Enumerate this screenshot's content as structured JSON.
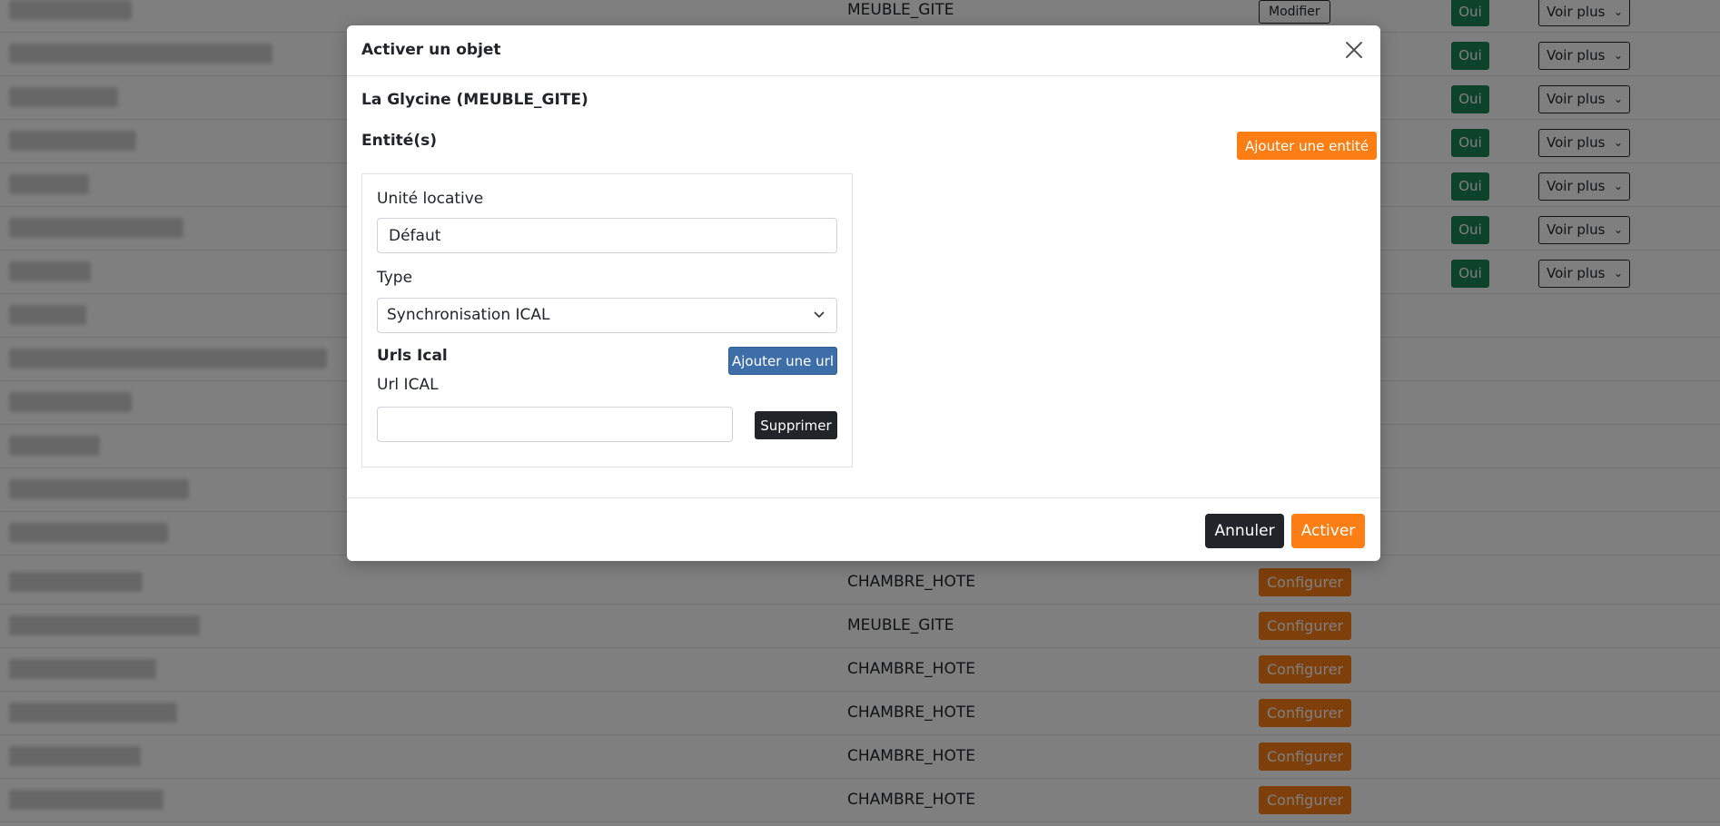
{
  "background_table": {
    "rows": [
      {
        "type": "MEUBLE_GITE",
        "action": "Modifier",
        "status": "Oui",
        "more": "Voir plus"
      },
      {
        "type": "",
        "action": "",
        "status": "Oui",
        "more": "Voir plus"
      },
      {
        "type": "",
        "action": "",
        "status": "Oui",
        "more": "Voir plus"
      },
      {
        "type": "",
        "action": "",
        "status": "Oui",
        "more": "Voir plus"
      },
      {
        "type": "",
        "action": "",
        "status": "Oui",
        "more": "Voir plus"
      },
      {
        "type": "",
        "action": "",
        "status": "Oui",
        "more": "Voir plus"
      },
      {
        "type": "",
        "action": "",
        "status": "Oui",
        "more": "Voir plus"
      },
      {
        "type": "",
        "action": "",
        "status": "",
        "more": ""
      },
      {
        "type": "",
        "action": "",
        "status": "",
        "more": ""
      },
      {
        "type": "",
        "action": "",
        "status": "",
        "more": ""
      },
      {
        "type": "",
        "action": "",
        "status": "",
        "more": ""
      },
      {
        "type": "",
        "action": "",
        "status": "",
        "more": ""
      },
      {
        "type": "",
        "action": "",
        "status": "",
        "more": ""
      },
      {
        "type": "CHAMBRE_HOTE",
        "action": "Configurer",
        "status": "",
        "more": ""
      },
      {
        "type": "MEUBLE_GITE",
        "action": "Configurer",
        "status": "",
        "more": ""
      },
      {
        "type": "CHAMBRE_HOTE",
        "action": "Configurer",
        "status": "",
        "more": ""
      },
      {
        "type": "CHAMBRE_HOTE",
        "action": "Configurer",
        "status": "",
        "more": ""
      },
      {
        "type": "CHAMBRE_HOTE",
        "action": "Configurer",
        "status": "",
        "more": ""
      },
      {
        "type": "CHAMBRE_HOTE",
        "action": "Configurer",
        "status": "",
        "more": ""
      }
    ]
  },
  "modal": {
    "title": "Activer un objet",
    "object_title": "La Glycine (MEUBLE_GITE)",
    "entities_title": "Entité(s)",
    "add_entity_label": "Ajouter une entité",
    "entity": {
      "unit_label": "Unité locative",
      "unit_value": "Défaut",
      "type_label": "Type",
      "type_value": "Synchronisation ICAL",
      "urls_title": "Urls Ical",
      "add_url_label": "Ajouter une url",
      "url_label": "Url ICAL",
      "url_value": "",
      "delete_label": "Supprimer"
    },
    "cancel_label": "Annuler",
    "activate_label": "Activer"
  },
  "colors": {
    "accent_orange": "#fd7e14",
    "success_green": "#198754",
    "primary_blue": "#3d6ea8",
    "dark": "#212529"
  }
}
